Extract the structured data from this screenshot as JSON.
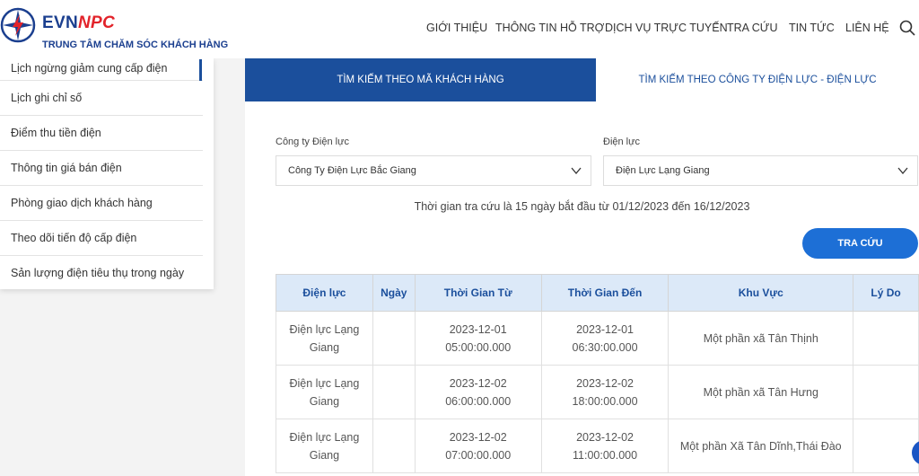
{
  "header": {
    "brand_evn": "EVN",
    "brand_npc": "NPC",
    "subtitle": "TRUNG TÂM CHĂM SÓC KHÁCH HÀNG",
    "nav": [
      "GIỚI THIỆU",
      "THÔNG TIN HỖ TRỢ",
      "DỊCH VỤ TRỰC TUYẾN",
      "TRA CỨU",
      "TIN TỨC",
      "LIÊN HỆ"
    ]
  },
  "sidebar": {
    "items": [
      "Lịch ngừng giảm cung cấp điện",
      "Lịch ghi chỉ số",
      "Điểm thu tiền điện",
      "Thông tin giá bán điện",
      "Phòng giao dịch khách hàng",
      "Theo dõi tiến độ cấp điện",
      "Sản lượng điện tiêu thụ trong ngày"
    ]
  },
  "tabs": {
    "active": "Tìm kiếm theo mã khách hàng",
    "inactive": "Tìm kiếm theo công ty điện lực - điện lực"
  },
  "form": {
    "company_label": "Công ty Điện lực",
    "company_value": "Công Ty Điện Lực Bắc Giang",
    "unit_label": "Điện lực",
    "unit_value": "Điện Lực Lạng Giang",
    "range_text": "Thời gian tra cứu là 15 ngày bắt đầu từ 01/12/2023 đến 16/12/2023",
    "search_button": "TRA CỨU"
  },
  "table": {
    "headers": [
      "Điện lực",
      "Ngày",
      "Thời Gian Từ",
      "Thời Gian Đến",
      "Khu Vực",
      "Lý Do"
    ],
    "rows": [
      {
        "dien_luc_1": "Điện lực Lạng",
        "dien_luc_2": "Giang",
        "ngay": "",
        "tu_date": "2023-12-01",
        "tu_time": "05:00:00.000",
        "den_date": "2023-12-01",
        "den_time": "06:30:00.000",
        "khu_vuc": "Một phần xã Tân Thịnh",
        "ly_do": ""
      },
      {
        "dien_luc_1": "Điện lực Lạng",
        "dien_luc_2": "Giang",
        "ngay": "",
        "tu_date": "2023-12-02",
        "tu_time": "06:00:00.000",
        "den_date": "2023-12-02",
        "den_time": "18:00:00.000",
        "khu_vuc": "Một phần xã Tân Hưng",
        "ly_do": ""
      },
      {
        "dien_luc_1": "Điện lực Lạng",
        "dien_luc_2": "Giang",
        "ngay": "",
        "tu_date": "2023-12-02",
        "tu_time": "07:00:00.000",
        "den_date": "2023-12-02",
        "den_time": "11:00:00.000",
        "khu_vuc": "Một phần Xã Tân Dĩnh,Thái Đào",
        "ly_do": ""
      }
    ]
  },
  "colors": {
    "primary": "#1b4f9c",
    "button": "#1d6fd6",
    "brand_red": "#e2232a",
    "header_row": "#dce9f8"
  }
}
